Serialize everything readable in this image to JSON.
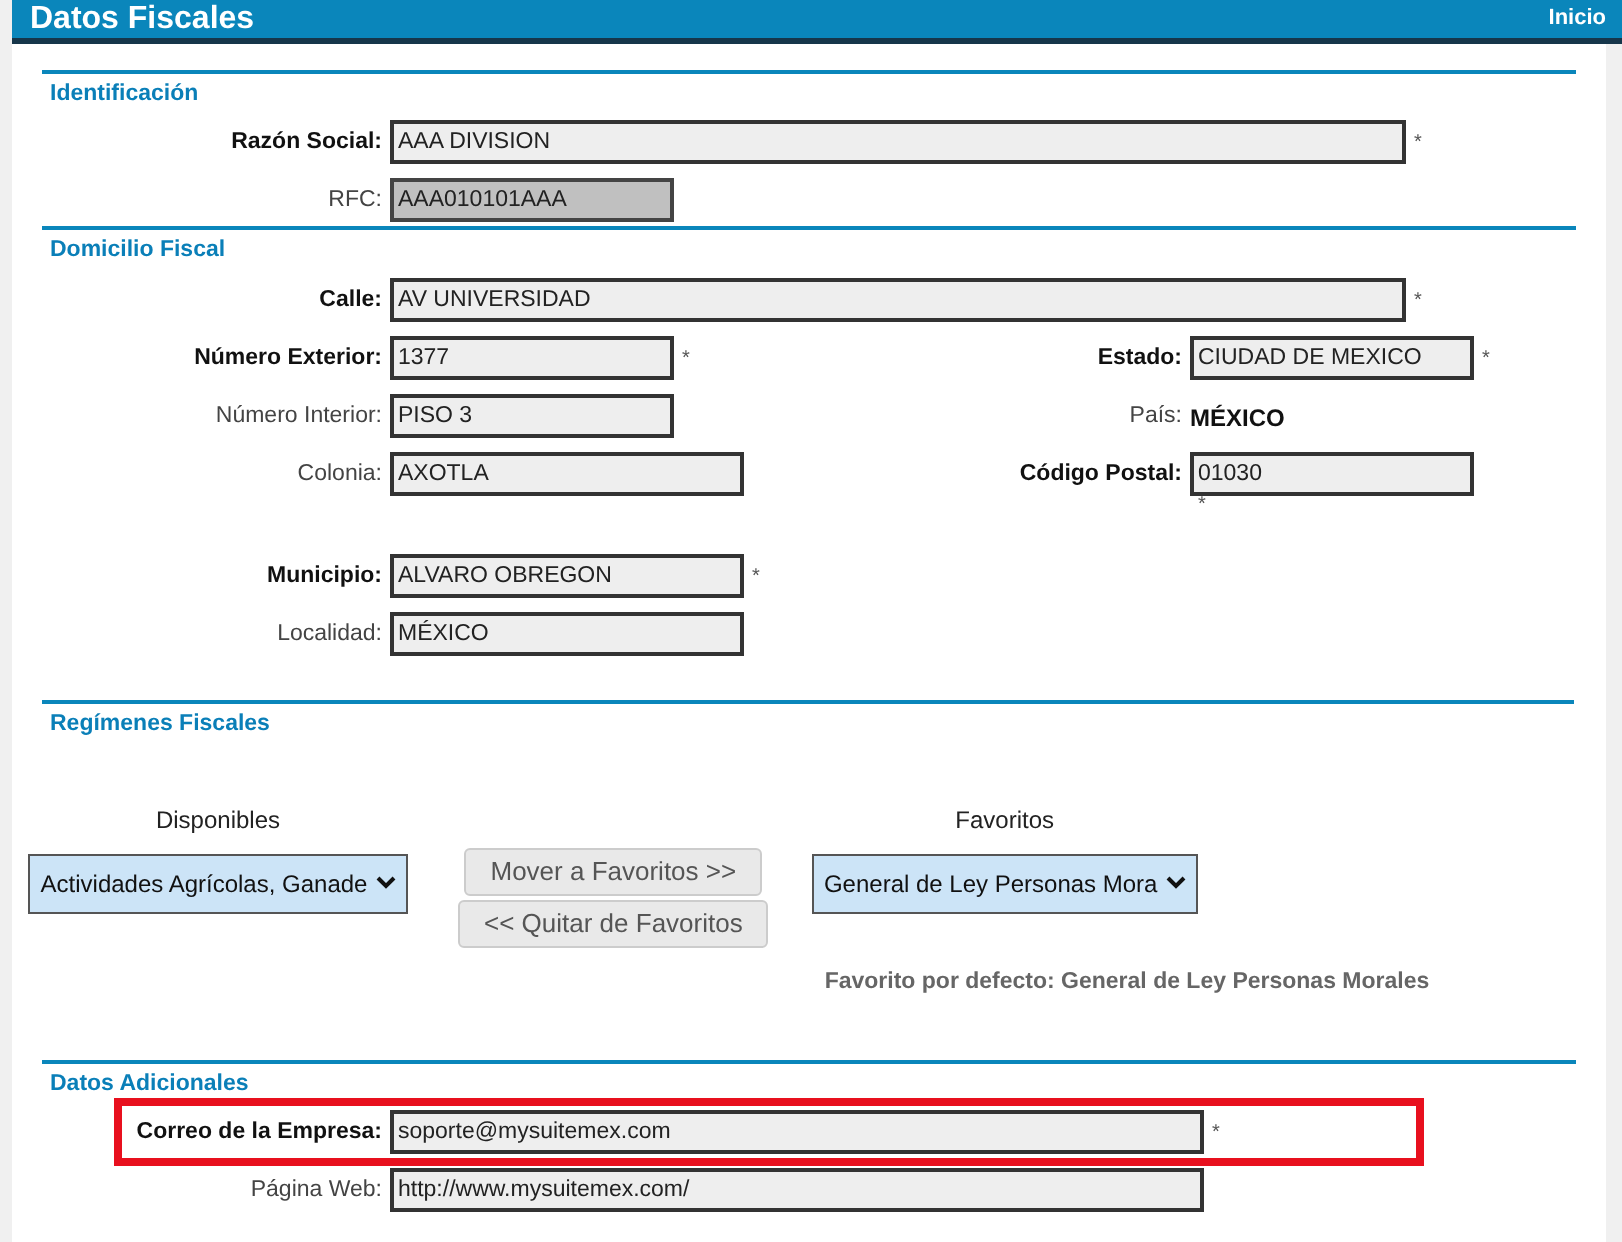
{
  "header": {
    "title": "Datos Fiscales",
    "link": "Inicio"
  },
  "identificacion": {
    "title": "Identificación",
    "rows": [
      {
        "left": {
          "kind": "input",
          "label": "Razón Social:",
          "value": "AAA DIVISION",
          "required": true,
          "disabled": false
        }
      },
      {
        "left": {
          "kind": "input",
          "label": "RFC:",
          "value": "AAA010101AAA",
          "required": false,
          "disabled": true
        }
      }
    ]
  },
  "domicilio": {
    "title": "Domicilio Fiscal",
    "rows": [
      {
        "left": {
          "kind": "input",
          "label": "Calle:",
          "value": "AV UNIVERSIDAD",
          "required": true,
          "disabled": false
        }
      },
      {
        "left": {
          "kind": "input",
          "label": "Número Exterior:",
          "value": "1377",
          "required": true,
          "disabled": false
        },
        "right": {
          "kind": "input",
          "label": "Estado:",
          "value": "CIUDAD DE MEXICO",
          "required": true,
          "disabled": false
        }
      },
      {
        "left": {
          "kind": "input",
          "label": "Número Interior:",
          "value": "PISO 3",
          "required": false,
          "disabled": false
        },
        "right": {
          "kind": "text",
          "label": "País:",
          "value": "MÉXICO"
        }
      },
      {
        "left": {
          "kind": "input",
          "label": "Colonia:",
          "value": "AXOTLA",
          "required": false,
          "disabled": false
        },
        "right": {
          "kind": "input",
          "label": "Código Postal:",
          "value": "01030",
          "required": true,
          "mark_below": true,
          "disabled": false
        }
      },
      {
        "left": {
          "kind": "input",
          "label": "Municipio:",
          "value": "ALVARO OBREGON",
          "required": true,
          "disabled": false
        }
      },
      {
        "left": {
          "kind": "input",
          "label": "Localidad:",
          "value": "MÉXICO",
          "required": false,
          "disabled": false
        }
      }
    ]
  },
  "regimenes": {
    "title": "Regímenes Fiscales",
    "available": {
      "label": "Disponibles",
      "value": "Actividades Agrícolas, Ganade"
    },
    "favorites": {
      "label": "Favoritos",
      "value": "General de Ley Personas Mora"
    },
    "buttons": [
      "Mover a Favoritos >>",
      "<< Quitar de Favoritos"
    ],
    "default_note": "Favorito por defecto: General de Ley Personas Morales"
  },
  "adicionales": {
    "title": "Datos Adicionales",
    "rows": [
      {
        "left": {
          "kind": "input",
          "label": "Correo de la Empresa:",
          "value": "soporte@mysuitemex.com",
          "required": true,
          "disabled": false,
          "highlighted": true
        }
      },
      {
        "left": {
          "kind": "input",
          "label": "Página Web:",
          "value": "http://www.mysuitemex.com/",
          "required": false,
          "disabled": false,
          "highlighted": false
        }
      }
    ]
  },
  "required_mark": "*"
}
